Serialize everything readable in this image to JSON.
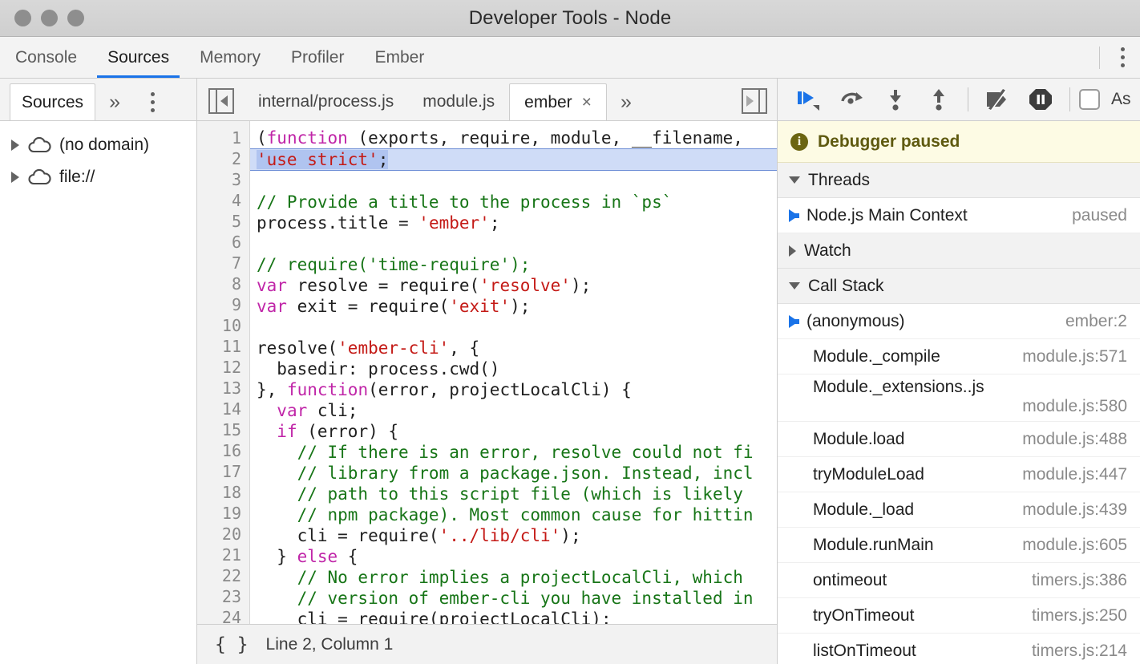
{
  "window": {
    "title": "Developer Tools - Node",
    "traffic_lights": [
      "close",
      "minimize",
      "zoom"
    ]
  },
  "main_tabs": [
    {
      "label": "Console",
      "active": false
    },
    {
      "label": "Sources",
      "active": true
    },
    {
      "label": "Memory",
      "active": false
    },
    {
      "label": "Profiler",
      "active": false
    },
    {
      "label": "Ember",
      "active": false
    }
  ],
  "main_tabs_overflow_icon": "kebab-menu-icon",
  "navigator": {
    "tab_label": "Sources",
    "more_label": "»",
    "kebab_icon": "kebab-menu-icon",
    "tree": [
      {
        "icon": "cloud-icon",
        "expander": "chevron-right-icon",
        "label": "(no domain)"
      },
      {
        "icon": "cloud-icon",
        "expander": "chevron-right-icon",
        "label": "file://"
      }
    ]
  },
  "editor": {
    "left_panel_toggle_icon": "show-navigator-icon",
    "right_panel_toggle_icon": "show-debugger-icon",
    "tabs": [
      {
        "label": "internal/process.js",
        "active": false,
        "closable": false
      },
      {
        "label": "module.js",
        "active": false,
        "closable": false
      },
      {
        "label": "ember",
        "active": true,
        "closable": true,
        "close_glyph": "×"
      }
    ],
    "tabs_overflow_label": "»",
    "status": {
      "pretty_print_icon": "{ }",
      "cursor_position": "Line 2, Column 1"
    },
    "lines": [
      {
        "n": "1",
        "tokens": [
          {
            "t": "(",
            "c": ""
          },
          {
            "t": "function",
            "c": "kw"
          },
          {
            "t": " (exports, require, module, __filename,",
            "c": ""
          }
        ]
      },
      {
        "n": "2",
        "exec": true,
        "tokens": [
          {
            "t": "'use strict'",
            "c": "str sel"
          },
          {
            "t": ";",
            "c": "sel"
          }
        ]
      },
      {
        "n": "3",
        "tokens": []
      },
      {
        "n": "4",
        "tokens": [
          {
            "t": "// Provide a title to the process in `ps`",
            "c": "cmt"
          }
        ]
      },
      {
        "n": "5",
        "tokens": [
          {
            "t": "process.title = ",
            "c": ""
          },
          {
            "t": "'ember'",
            "c": "str"
          },
          {
            "t": ";",
            "c": ""
          }
        ]
      },
      {
        "n": "6",
        "tokens": []
      },
      {
        "n": "7",
        "tokens": [
          {
            "t": "// require('time-require');",
            "c": "cmt"
          }
        ]
      },
      {
        "n": "8",
        "tokens": [
          {
            "t": "var",
            "c": "kw"
          },
          {
            "t": " resolve = require(",
            "c": ""
          },
          {
            "t": "'resolve'",
            "c": "str"
          },
          {
            "t": ");",
            "c": ""
          }
        ]
      },
      {
        "n": "9",
        "tokens": [
          {
            "t": "var",
            "c": "kw"
          },
          {
            "t": " exit = require(",
            "c": ""
          },
          {
            "t": "'exit'",
            "c": "str"
          },
          {
            "t": ");",
            "c": ""
          }
        ]
      },
      {
        "n": "10",
        "tokens": []
      },
      {
        "n": "11",
        "tokens": [
          {
            "t": "resolve(",
            "c": ""
          },
          {
            "t": "'ember-cli'",
            "c": "str"
          },
          {
            "t": ", {",
            "c": ""
          }
        ]
      },
      {
        "n": "12",
        "tokens": [
          {
            "t": "  basedir: process.cwd()",
            "c": ""
          }
        ]
      },
      {
        "n": "13",
        "tokens": [
          {
            "t": "}, ",
            "c": ""
          },
          {
            "t": "function",
            "c": "kw"
          },
          {
            "t": "(error, projectLocalCli) {",
            "c": ""
          }
        ]
      },
      {
        "n": "14",
        "tokens": [
          {
            "t": "  ",
            "c": ""
          },
          {
            "t": "var",
            "c": "kw"
          },
          {
            "t": " cli;",
            "c": ""
          }
        ]
      },
      {
        "n": "15",
        "tokens": [
          {
            "t": "  ",
            "c": ""
          },
          {
            "t": "if",
            "c": "kw"
          },
          {
            "t": " (error) {",
            "c": ""
          }
        ]
      },
      {
        "n": "16",
        "tokens": [
          {
            "t": "    // If there is an error, resolve could not fi",
            "c": "cmt"
          }
        ]
      },
      {
        "n": "17",
        "tokens": [
          {
            "t": "    // library from a package.json. Instead, incl",
            "c": "cmt"
          }
        ]
      },
      {
        "n": "18",
        "tokens": [
          {
            "t": "    // path to this script file (which is likely",
            "c": "cmt"
          }
        ]
      },
      {
        "n": "19",
        "tokens": [
          {
            "t": "    // npm package). Most common cause for hittin",
            "c": "cmt"
          }
        ]
      },
      {
        "n": "20",
        "tokens": [
          {
            "t": "    cli = require(",
            "c": ""
          },
          {
            "t": "'../lib/cli'",
            "c": "str"
          },
          {
            "t": ");",
            "c": ""
          }
        ]
      },
      {
        "n": "21",
        "tokens": [
          {
            "t": "  } ",
            "c": ""
          },
          {
            "t": "else",
            "c": "kw"
          },
          {
            "t": " {",
            "c": ""
          }
        ]
      },
      {
        "n": "22",
        "tokens": [
          {
            "t": "    // No error implies a projectLocalCli, which ",
            "c": "cmt"
          }
        ]
      },
      {
        "n": "23",
        "tokens": [
          {
            "t": "    // version of ember-cli you have installed in",
            "c": "cmt"
          }
        ]
      },
      {
        "n": "24",
        "tokens": [
          {
            "t": "    cli = require(projectLocalCli);",
            "c": ""
          }
        ]
      }
    ]
  },
  "debugger": {
    "toolbar": [
      {
        "name": "resume-button",
        "icon": "resume-icon",
        "accent": "#1a73e8"
      },
      {
        "name": "step-over-button",
        "icon": "step-over-icon",
        "accent": "#5a5a5a"
      },
      {
        "name": "step-into-button",
        "icon": "step-into-icon",
        "accent": "#5a5a5a"
      },
      {
        "name": "step-out-button",
        "icon": "step-out-icon",
        "accent": "#5a5a5a"
      },
      {
        "name": "deactivate-breakpoints-button",
        "icon": "deactivate-breakpoints-icon",
        "accent": "#5a5a5a"
      },
      {
        "name": "pause-on-exceptions-button",
        "icon": "pause-on-exceptions-icon",
        "accent": "#3c3c3c"
      }
    ],
    "async_checkbox": {
      "label": "As",
      "checked": false
    },
    "paused_banner": {
      "icon": "info-icon",
      "glyph": "i",
      "text": "Debugger paused"
    },
    "sections": {
      "threads": {
        "title": "Threads",
        "expanded": true
      },
      "watch": {
        "title": "Watch",
        "expanded": false
      },
      "call_stack": {
        "title": "Call Stack",
        "expanded": true
      }
    },
    "threads": [
      {
        "name": "Node.js Main Context",
        "state": "paused",
        "selected": true
      }
    ],
    "call_stack": [
      {
        "name": "(anonymous)",
        "location": "ember:2",
        "selected": true,
        "wrapped": false
      },
      {
        "name": "Module._compile",
        "location": "module.js:571",
        "selected": false,
        "wrapped": false
      },
      {
        "name": "Module._extensions..js",
        "location": "module.js:580",
        "selected": false,
        "wrapped": true
      },
      {
        "name": "Module.load",
        "location": "module.js:488",
        "selected": false,
        "wrapped": false
      },
      {
        "name": "tryModuleLoad",
        "location": "module.js:447",
        "selected": false,
        "wrapped": false
      },
      {
        "name": "Module._load",
        "location": "module.js:439",
        "selected": false,
        "wrapped": false
      },
      {
        "name": "Module.runMain",
        "location": "module.js:605",
        "selected": false,
        "wrapped": false
      },
      {
        "name": "ontimeout",
        "location": "timers.js:386",
        "selected": false,
        "wrapped": false
      },
      {
        "name": "tryOnTimeout",
        "location": "timers.js:250",
        "selected": false,
        "wrapped": false
      },
      {
        "name": "listOnTimeout",
        "location": "timers.js:214",
        "selected": false,
        "wrapped": false
      }
    ]
  },
  "colors": {
    "accent_blue": "#1a73e8",
    "exec_line_bg": "#cfdcf7",
    "paused_banner_bg": "#fdfbe4",
    "keyword": "#c026a8",
    "string": "#c41a16",
    "comment": "#177517"
  }
}
